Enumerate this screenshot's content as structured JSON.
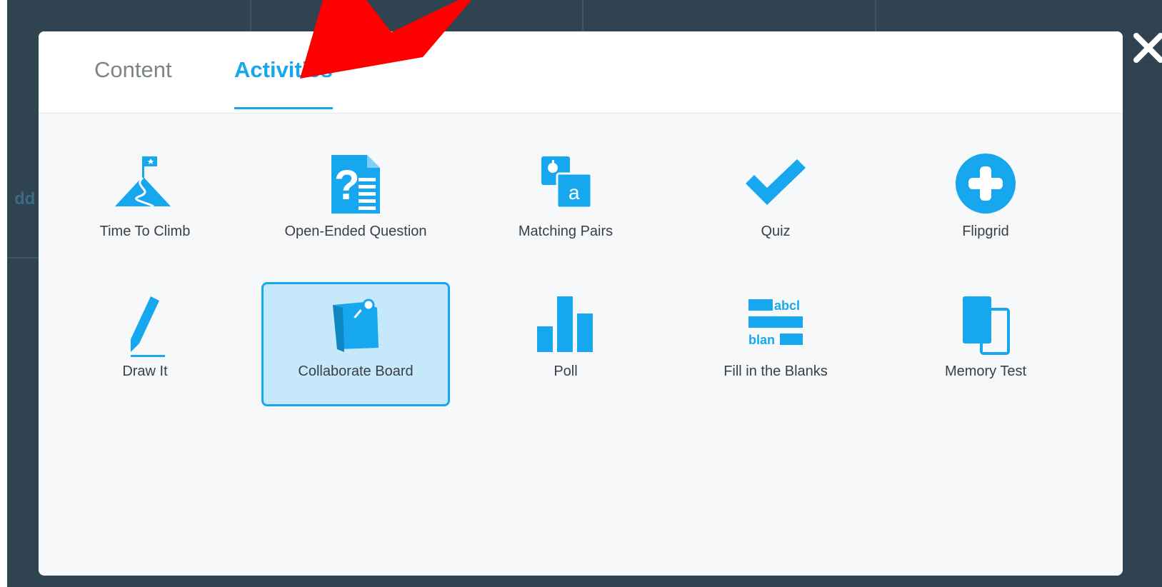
{
  "tabs": [
    {
      "label": "Content",
      "active": false
    },
    {
      "label": "Activities",
      "active": true
    }
  ],
  "activities": [
    {
      "label": "Time To Climb",
      "icon": "mountain-flag-icon"
    },
    {
      "label": "Open-Ended Question",
      "icon": "question-document-icon"
    },
    {
      "label": "Matching Pairs",
      "icon": "matching-cards-icon"
    },
    {
      "label": "Quiz",
      "icon": "checkmark-icon"
    },
    {
      "label": "Flipgrid",
      "icon": "plus-circle-icon"
    },
    {
      "label": "Draw It",
      "icon": "pencil-icon"
    },
    {
      "label": "Collaborate Board",
      "icon": "pinned-note-icon",
      "selected": true
    },
    {
      "label": "Poll",
      "icon": "bar-chart-icon"
    },
    {
      "label": "Fill in the Blanks",
      "icon": "fill-blanks-icon",
      "text_top": "abcl",
      "text_bottom": "blan"
    },
    {
      "label": "Memory Test",
      "icon": "memory-cards-icon"
    }
  ],
  "matching_pairs_letter": "a",
  "background": {
    "partial_text": "dd"
  },
  "colors": {
    "accent": "#16a7ee",
    "selected_bg": "#c6e8fb",
    "overlay": "#2f4350",
    "annotation_arrow": "#ff0000"
  }
}
